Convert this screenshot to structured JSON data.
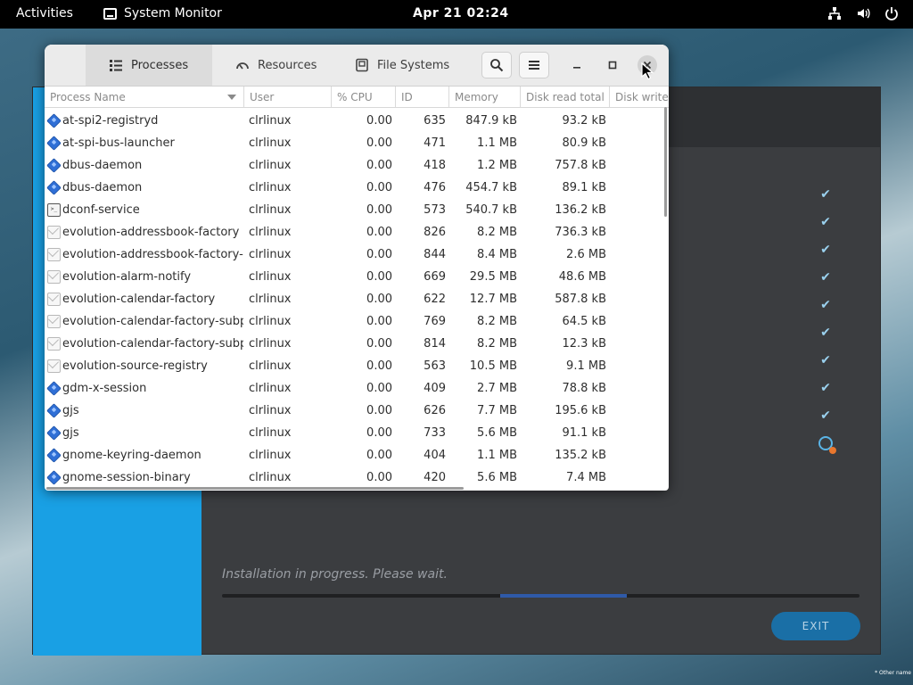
{
  "topbar": {
    "activities": "Activities",
    "app_name": "System Monitor",
    "clock": "Apr 21  02:24",
    "tray_icons": [
      "network-icon",
      "volume-icon",
      "power-icon"
    ]
  },
  "installer": {
    "status_text": "Installation in progress. Please wait.",
    "exit_label": "EXIT",
    "progress_fraction": 0.2,
    "accent_color": "#19a0e4",
    "check_count": 9,
    "corner_note": "* Other name"
  },
  "sysmon": {
    "tabs": [
      {
        "label": "Processes",
        "icon": "list-icon",
        "active": true
      },
      {
        "label": "Resources",
        "icon": "gauge-icon",
        "active": false
      },
      {
        "label": "File Systems",
        "icon": "disk-icon",
        "active": false
      }
    ],
    "columns": [
      "Process Name",
      "User",
      "% CPU",
      "ID",
      "Memory",
      "Disk read total",
      "Disk write"
    ],
    "processes": [
      {
        "icon": "gear",
        "name": "at-spi2-registryd",
        "user": "clrlinux",
        "cpu": "0.00",
        "id": "635",
        "memory": "847.9 kB",
        "disk_read": "93.2 kB"
      },
      {
        "icon": "gear",
        "name": "at-spi-bus-launcher",
        "user": "clrlinux",
        "cpu": "0.00",
        "id": "471",
        "memory": "1.1 MB",
        "disk_read": "80.9 kB"
      },
      {
        "icon": "gear",
        "name": "dbus-daemon",
        "user": "clrlinux",
        "cpu": "0.00",
        "id": "418",
        "memory": "1.2 MB",
        "disk_read": "757.8 kB"
      },
      {
        "icon": "gear",
        "name": "dbus-daemon",
        "user": "clrlinux",
        "cpu": "0.00",
        "id": "476",
        "memory": "454.7 kB",
        "disk_read": "89.1 kB"
      },
      {
        "icon": "term",
        "name": "dconf-service",
        "user": "clrlinux",
        "cpu": "0.00",
        "id": "573",
        "memory": "540.7 kB",
        "disk_read": "136.2 kB"
      },
      {
        "icon": "mail",
        "name": "evolution-addressbook-factory",
        "user": "clrlinux",
        "cpu": "0.00",
        "id": "826",
        "memory": "8.2 MB",
        "disk_read": "736.3 kB"
      },
      {
        "icon": "mail",
        "name": "evolution-addressbook-factory-su",
        "user": "clrlinux",
        "cpu": "0.00",
        "id": "844",
        "memory": "8.4 MB",
        "disk_read": "2.6 MB"
      },
      {
        "icon": "mail",
        "name": "evolution-alarm-notify",
        "user": "clrlinux",
        "cpu": "0.00",
        "id": "669",
        "memory": "29.5 MB",
        "disk_read": "48.6 MB"
      },
      {
        "icon": "mail",
        "name": "evolution-calendar-factory",
        "user": "clrlinux",
        "cpu": "0.00",
        "id": "622",
        "memory": "12.7 MB",
        "disk_read": "587.8 kB"
      },
      {
        "icon": "mail",
        "name": "evolution-calendar-factory-subpro",
        "user": "clrlinux",
        "cpu": "0.00",
        "id": "769",
        "memory": "8.2 MB",
        "disk_read": "64.5 kB"
      },
      {
        "icon": "mail",
        "name": "evolution-calendar-factory-subpro",
        "user": "clrlinux",
        "cpu": "0.00",
        "id": "814",
        "memory": "8.2 MB",
        "disk_read": "12.3 kB"
      },
      {
        "icon": "mail",
        "name": "evolution-source-registry",
        "user": "clrlinux",
        "cpu": "0.00",
        "id": "563",
        "memory": "10.5 MB",
        "disk_read": "9.1 MB"
      },
      {
        "icon": "gear",
        "name": "gdm-x-session",
        "user": "clrlinux",
        "cpu": "0.00",
        "id": "409",
        "memory": "2.7 MB",
        "disk_read": "78.8 kB"
      },
      {
        "icon": "gear",
        "name": "gjs",
        "user": "clrlinux",
        "cpu": "0.00",
        "id": "626",
        "memory": "7.7 MB",
        "disk_read": "195.6 kB"
      },
      {
        "icon": "gear",
        "name": "gjs",
        "user": "clrlinux",
        "cpu": "0.00",
        "id": "733",
        "memory": "5.6 MB",
        "disk_read": "91.1 kB"
      },
      {
        "icon": "gear",
        "name": "gnome-keyring-daemon",
        "user": "clrlinux",
        "cpu": "0.00",
        "id": "404",
        "memory": "1.1 MB",
        "disk_read": "135.2 kB"
      },
      {
        "icon": "gear",
        "name": "gnome-session-binary",
        "user": "clrlinux",
        "cpu": "0.00",
        "id": "420",
        "memory": "5.6 MB",
        "disk_read": "7.4 MB"
      }
    ]
  }
}
